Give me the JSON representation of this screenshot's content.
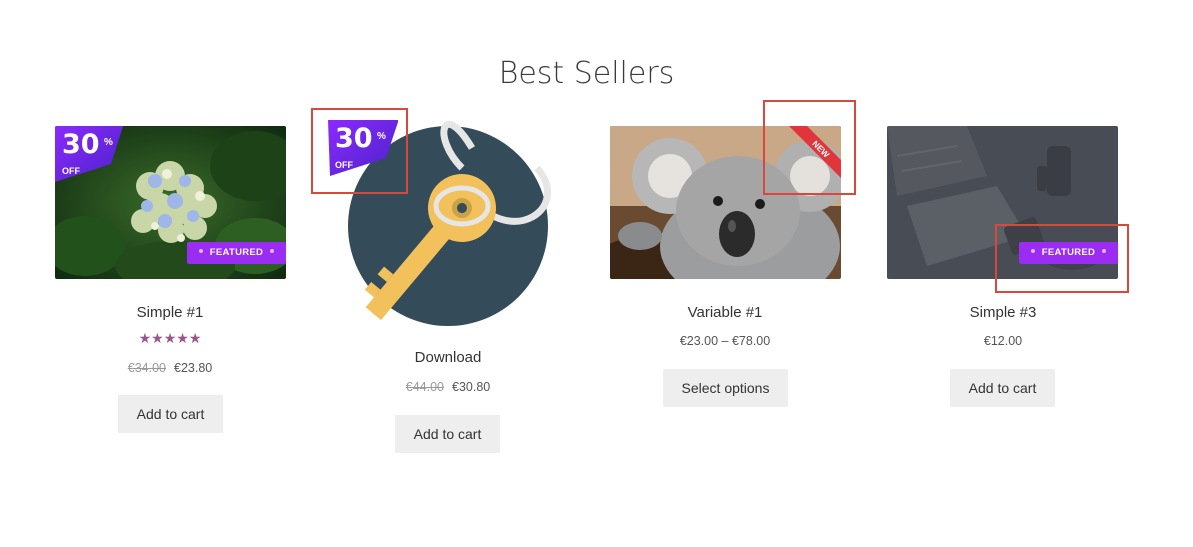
{
  "section": {
    "title": "Best Sellers"
  },
  "badges": {
    "sale_number": "30",
    "sale_percent": "%",
    "sale_off": "OFF",
    "featured": "FEATURED",
    "new": "NEW"
  },
  "products": [
    {
      "name": "Simple #1",
      "rating": "★★★★★",
      "old_price": "€34.00",
      "price": "€23.80",
      "button": "Add to cart"
    },
    {
      "name": "Download",
      "old_price": "€44.00",
      "price": "€30.80",
      "button": "Add to cart"
    },
    {
      "name": "Variable #1",
      "price": "€23.00 – €78.00",
      "button": "Select options"
    },
    {
      "name": "Simple #3",
      "price": "€12.00",
      "button": "Add to cart"
    }
  ],
  "colors": {
    "featured": "#9b2cf2",
    "sale_gradient_start": "#8d2bff",
    "sale_gradient_end": "#4b21c9",
    "new_ribbon": "#e0353b",
    "highlight": "#d9473f"
  }
}
